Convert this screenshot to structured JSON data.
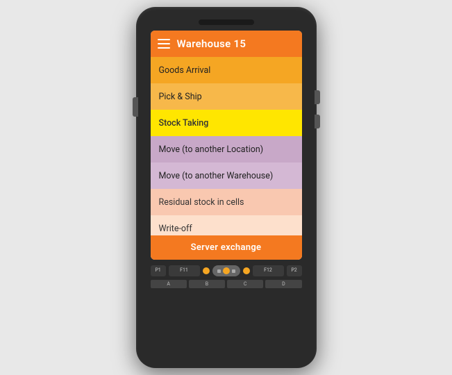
{
  "header": {
    "title": "Warehouse 15",
    "menu_icon": "hamburger"
  },
  "menu": {
    "items": [
      {
        "label": "Goods Arrival",
        "bg": "#f5a623"
      },
      {
        "label": "Pick & Ship",
        "bg": "#f7b84a"
      },
      {
        "label": "Stock Taking",
        "bg": "#ffe600"
      },
      {
        "label": "Move (to another Location)",
        "bg": "#c8a8c8"
      },
      {
        "label": "Move (to another Warehouse)",
        "bg": "#d4b8d4"
      },
      {
        "label": "Residual stock in cells",
        "bg": "#f9c8b0"
      },
      {
        "label": "Write-off",
        "bg": "#fde0cc"
      }
    ],
    "server_exchange_label": "Server exchange"
  },
  "keypad": {
    "fn_keys": [
      "F11",
      "F12"
    ],
    "p_keys": [
      "P1",
      "P2"
    ],
    "nav_keys": [
      "A",
      "B",
      "C",
      "D"
    ]
  }
}
